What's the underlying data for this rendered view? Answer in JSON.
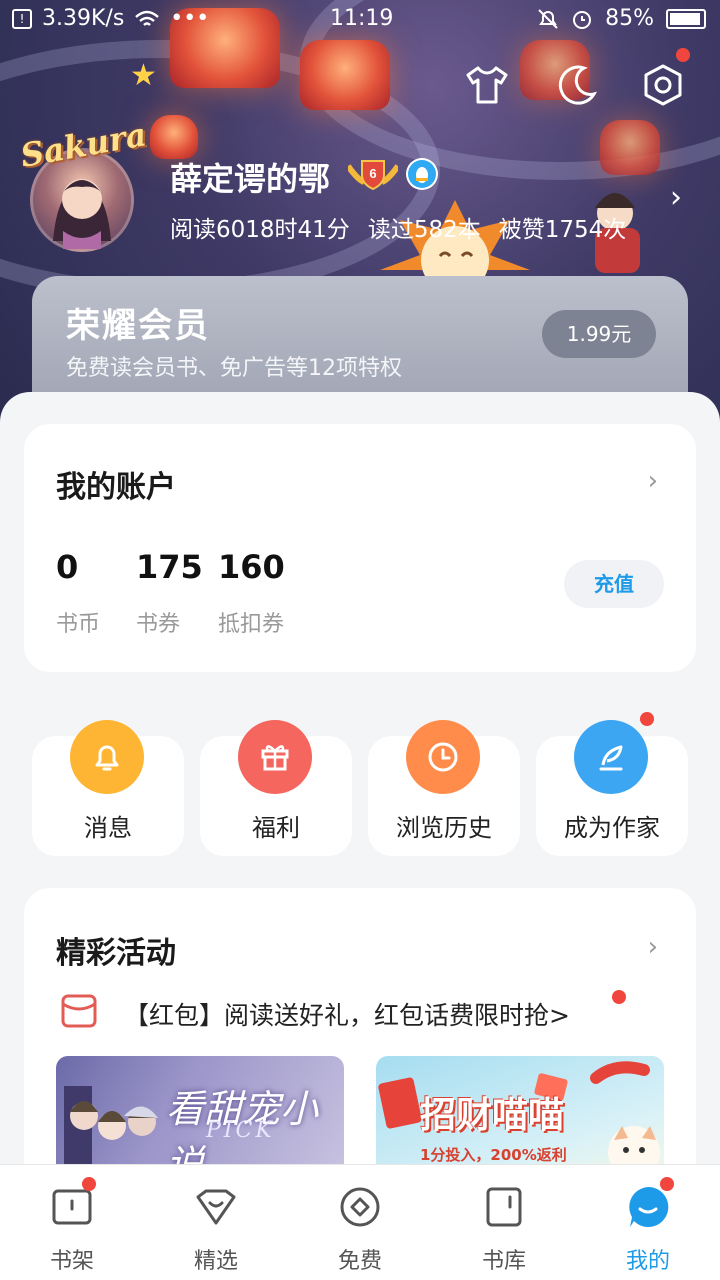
{
  "status_bar": {
    "speed": "3.39K/s",
    "dots": "•••",
    "time": "11:19",
    "battery": "85%"
  },
  "header_icons": [
    "tshirt-icon",
    "moon-icon",
    "settings-hex-icon"
  ],
  "profile": {
    "avatar_brand": "Sakura",
    "username": "薛定谔的鄂",
    "level": "6",
    "stats": [
      "阅读6018时41分",
      "读过582本",
      "被赞1754次"
    ]
  },
  "vip": {
    "title": "荣耀会员",
    "desc": "免费读会员书、免广告等12项特权",
    "price": "1.99元"
  },
  "account": {
    "title": "我的账户",
    "items": [
      {
        "value": "0",
        "label": "书币"
      },
      {
        "value": "175",
        "label": "书券"
      },
      {
        "value": "160",
        "label": "抵扣券"
      }
    ],
    "recharge": "充值"
  },
  "quick_actions": [
    {
      "label": "消息",
      "icon": "bell-icon",
      "color": "#ffb534"
    },
    {
      "label": "福利",
      "icon": "gift-icon",
      "color": "#f4665e"
    },
    {
      "label": "浏览历史",
      "icon": "clock-icon",
      "color": "#ff8c4a"
    },
    {
      "label": "成为作家",
      "icon": "feather-pen-icon",
      "color": "#3da6f2"
    }
  ],
  "events": {
    "title": "精彩活动",
    "redpacket_text": "【红包】阅读送好礼，红包话费限时抢>",
    "banners": [
      {
        "title": "看甜宠小说",
        "sub": "PICK"
      },
      {
        "title": "招财喵喵",
        "sub": "1分投入，200%返利"
      }
    ]
  },
  "tabbar": [
    {
      "label": "书架",
      "icon": "bookshelf-icon",
      "active": false,
      "dot": true
    },
    {
      "label": "精选",
      "icon": "diamond-icon",
      "active": false,
      "dot": false
    },
    {
      "label": "免费",
      "icon": "coin-icon",
      "active": false,
      "dot": false
    },
    {
      "label": "书库",
      "icon": "book-icon",
      "active": false,
      "dot": false
    },
    {
      "label": "我的",
      "icon": "profile-face-icon",
      "active": true,
      "dot": true
    }
  ],
  "colors": {
    "accent": "#1e9be8",
    "red_dot": "#f1463d",
    "vip_button": "#7e8393"
  }
}
